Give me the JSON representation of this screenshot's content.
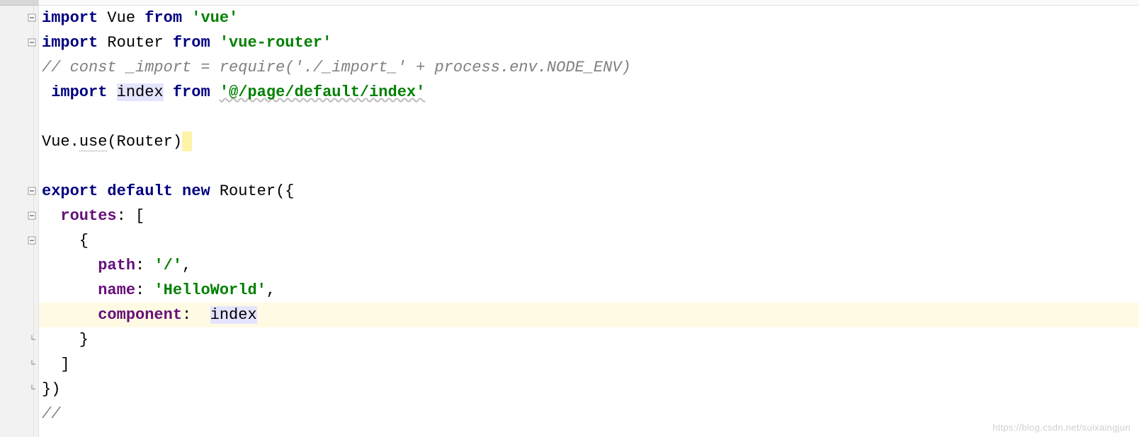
{
  "code": {
    "lines": [
      {
        "tokens": [
          {
            "t": "import",
            "c": "kw"
          },
          {
            "t": " ",
            "c": "plain"
          },
          {
            "t": "Vue",
            "c": "ident"
          },
          {
            "t": " ",
            "c": "plain"
          },
          {
            "t": "from",
            "c": "kw"
          },
          {
            "t": " ",
            "c": "plain"
          },
          {
            "t": "'vue'",
            "c": "str"
          }
        ],
        "fold": "minus",
        "highlighted": false
      },
      {
        "tokens": [
          {
            "t": "import",
            "c": "kw"
          },
          {
            "t": " ",
            "c": "plain"
          },
          {
            "t": "Router",
            "c": "ident"
          },
          {
            "t": " ",
            "c": "plain"
          },
          {
            "t": "from",
            "c": "kw"
          },
          {
            "t": " ",
            "c": "plain"
          },
          {
            "t": "'vue-router'",
            "c": "str"
          }
        ],
        "fold": "minus",
        "highlighted": false
      },
      {
        "tokens": [
          {
            "t": "// const _import = require('./_import_' + process.env.NODE_ENV)",
            "c": "cmt"
          }
        ],
        "fold": null,
        "highlighted": false
      },
      {
        "tokens": [
          {
            "t": " ",
            "c": "plain"
          },
          {
            "t": "import",
            "c": "kw"
          },
          {
            "t": " ",
            "c": "plain"
          },
          {
            "t": "index",
            "c": "ident",
            "bg": "hlbg"
          },
          {
            "t": " ",
            "c": "plain"
          },
          {
            "t": "from",
            "c": "kw"
          },
          {
            "t": " ",
            "c": "plain"
          },
          {
            "t": "'@/page/default/index'",
            "c": "str",
            "wavy": true
          }
        ],
        "fold": null,
        "highlighted": false
      },
      {
        "tokens": [
          {
            "t": " ",
            "c": "plain"
          }
        ],
        "fold": null,
        "highlighted": false
      },
      {
        "tokens": [
          {
            "t": "Vue.",
            "c": "ident"
          },
          {
            "t": "use",
            "c": "ident",
            "dot": true
          },
          {
            "t": "(Router)",
            "c": "ident"
          },
          {
            "t": "",
            "c": "cursor-bg"
          }
        ],
        "fold": null,
        "highlighted": false
      },
      {
        "tokens": [
          {
            "t": " ",
            "c": "plain"
          }
        ],
        "fold": null,
        "highlighted": false
      },
      {
        "tokens": [
          {
            "t": "export default ",
            "c": "kw"
          },
          {
            "t": "new ",
            "c": "kw"
          },
          {
            "t": "Router({",
            "c": "ident"
          }
        ],
        "fold": "minus",
        "highlighted": false
      },
      {
        "tokens": [
          {
            "t": "  ",
            "c": "plain"
          },
          {
            "t": "routes",
            "c": "prop"
          },
          {
            "t": ": [",
            "c": "plain"
          }
        ],
        "fold": "minus",
        "highlighted": false
      },
      {
        "tokens": [
          {
            "t": "    {",
            "c": "plain"
          }
        ],
        "fold": "minus",
        "highlighted": false
      },
      {
        "tokens": [
          {
            "t": "      ",
            "c": "plain"
          },
          {
            "t": "path",
            "c": "prop"
          },
          {
            "t": ": ",
            "c": "plain"
          },
          {
            "t": "'/'",
            "c": "str"
          },
          {
            "t": ",",
            "c": "plain"
          }
        ],
        "fold": null,
        "highlighted": false
      },
      {
        "tokens": [
          {
            "t": "      ",
            "c": "plain"
          },
          {
            "t": "name",
            "c": "prop"
          },
          {
            "t": ": ",
            "c": "plain"
          },
          {
            "t": "'HelloWorld'",
            "c": "str"
          },
          {
            "t": ",",
            "c": "plain"
          }
        ],
        "fold": null,
        "highlighted": false
      },
      {
        "tokens": [
          {
            "t": "      ",
            "c": "plain"
          },
          {
            "t": "component",
            "c": "prop"
          },
          {
            "t": ":  ",
            "c": "plain"
          },
          {
            "t": "index",
            "c": "ident",
            "bg": "hlbg"
          }
        ],
        "fold": null,
        "highlighted": true
      },
      {
        "tokens": [
          {
            "t": "    }",
            "c": "plain"
          }
        ],
        "fold": "end",
        "highlighted": false
      },
      {
        "tokens": [
          {
            "t": "  ]",
            "c": "plain"
          }
        ],
        "fold": "end",
        "highlighted": false
      },
      {
        "tokens": [
          {
            "t": "})",
            "c": "plain"
          }
        ],
        "fold": "end",
        "highlighted": false
      },
      {
        "tokens": [
          {
            "t": "//",
            "c": "cmt"
          }
        ],
        "fold": null,
        "highlighted": false
      }
    ]
  },
  "watermark": "https://blog.csdn.net/suixaingjun"
}
